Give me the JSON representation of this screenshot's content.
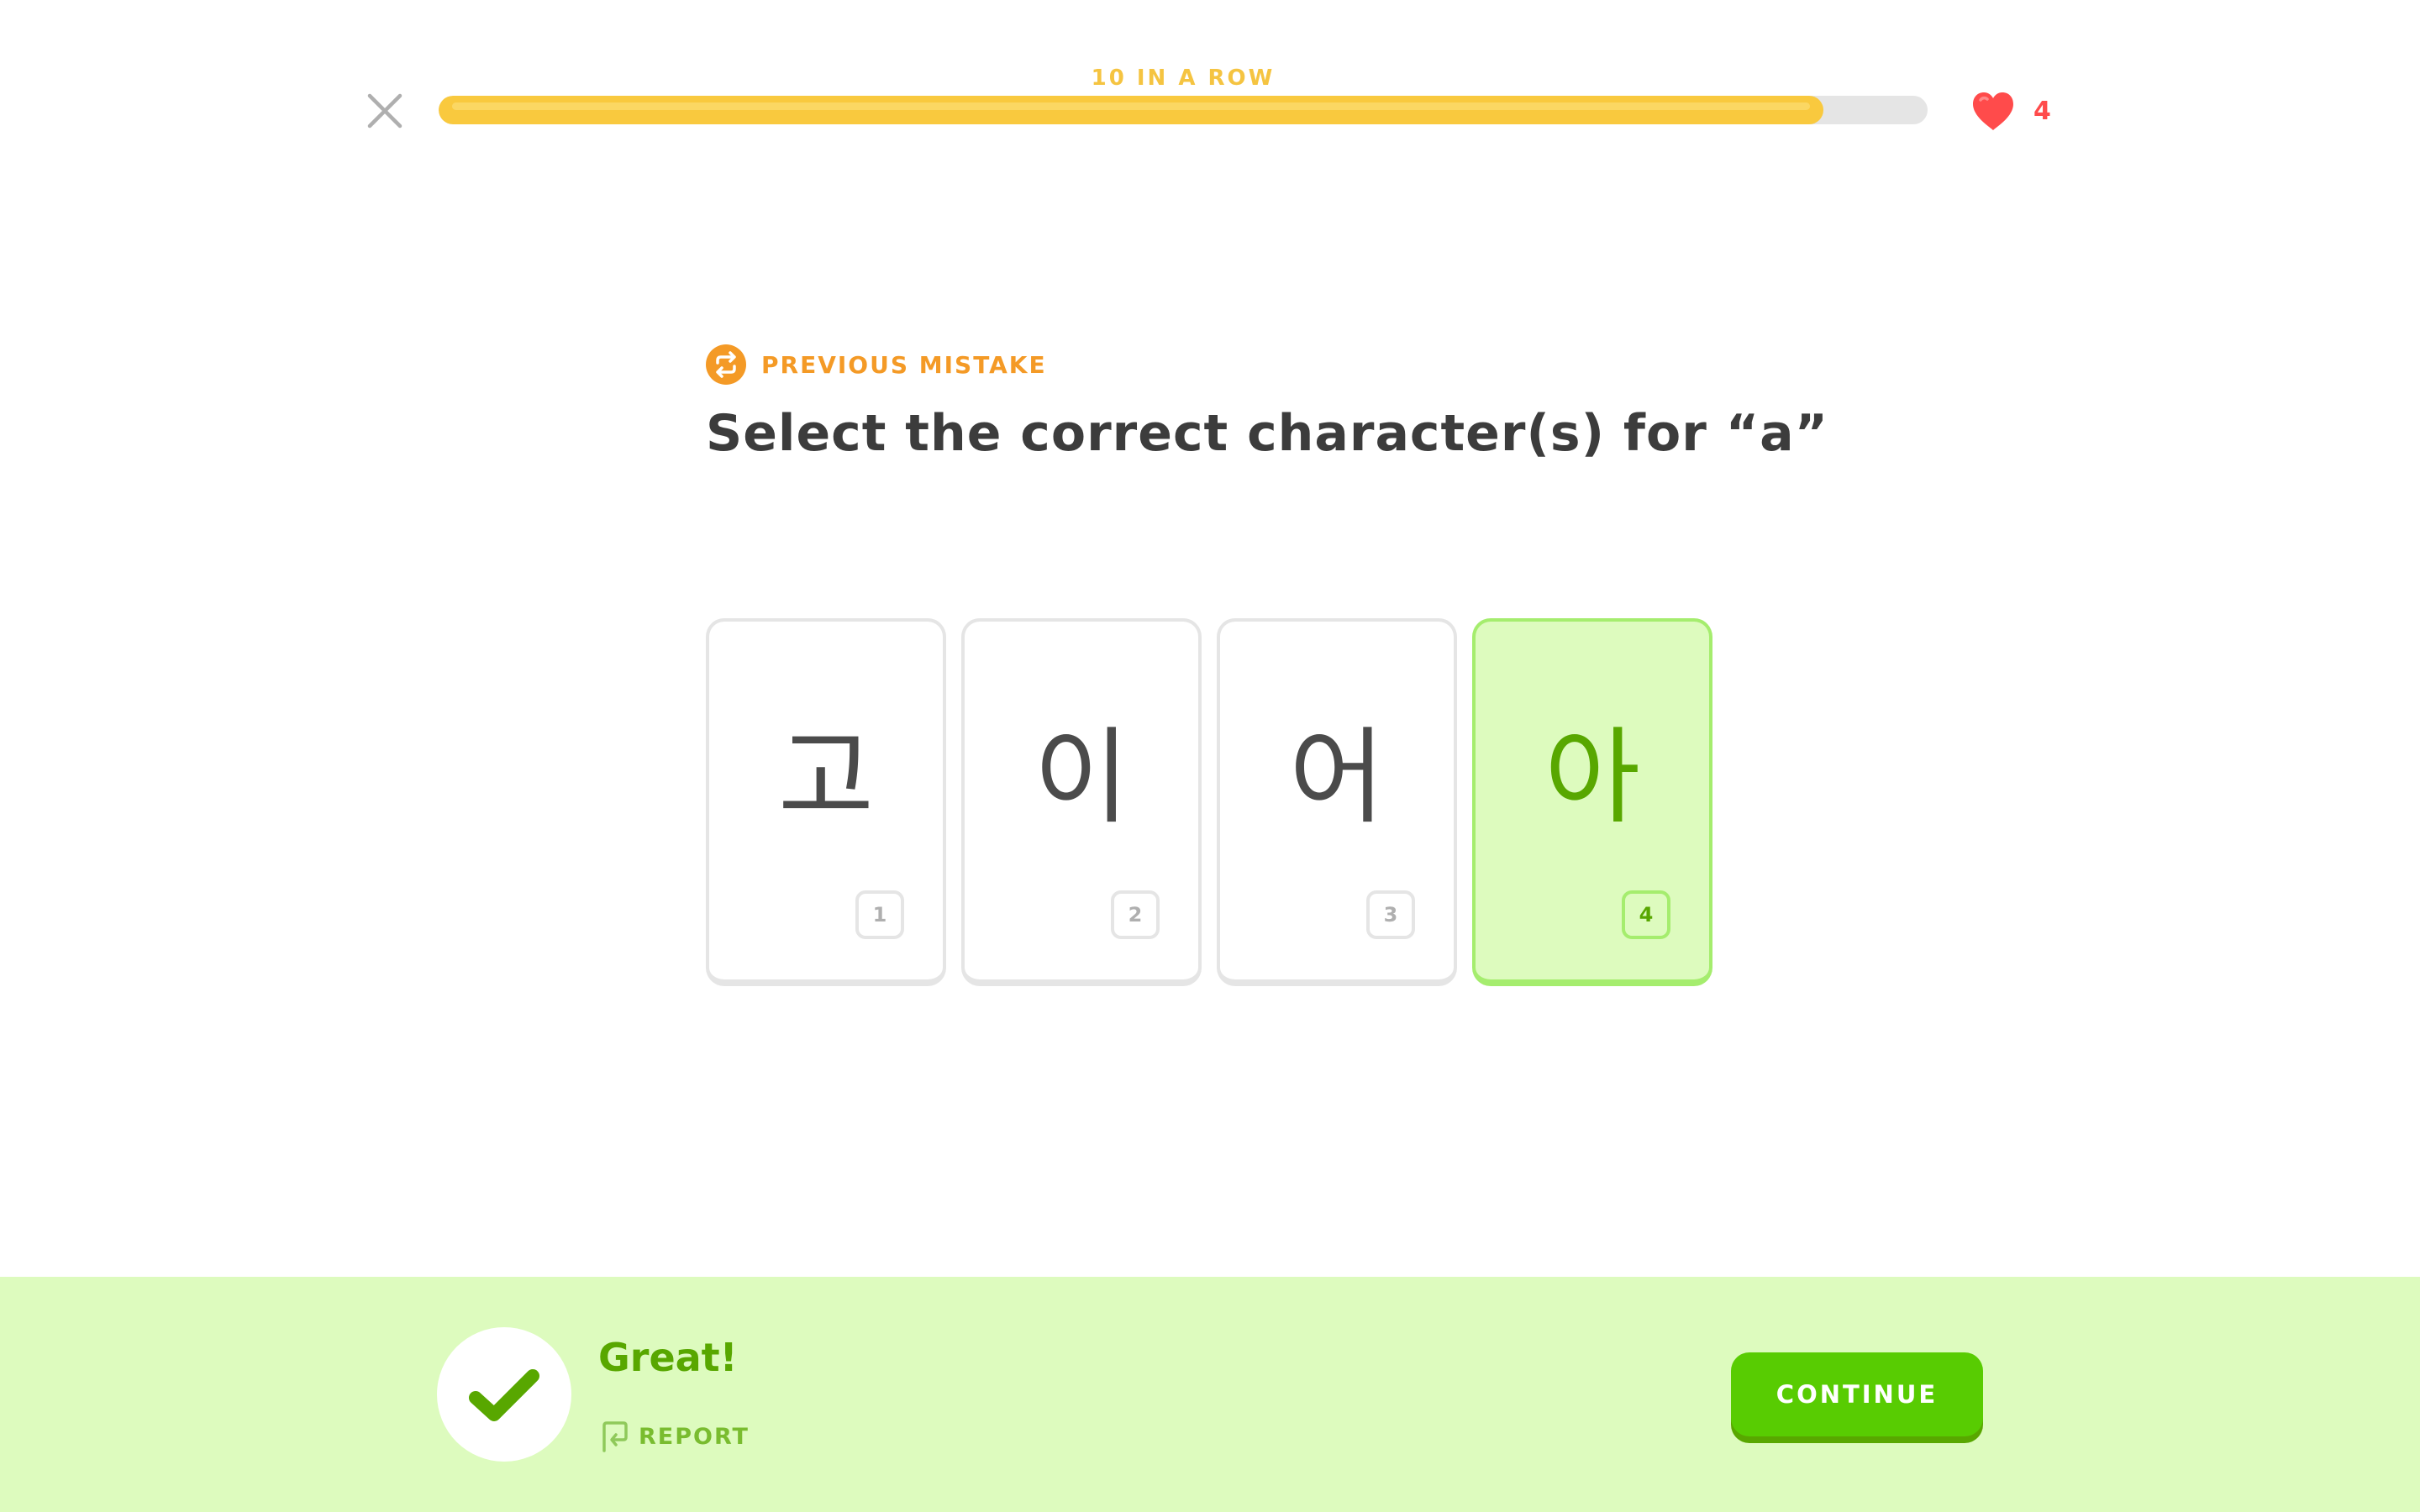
{
  "header": {
    "streak_label": "10 IN A ROW",
    "progress": 0.93,
    "hearts_count": "4",
    "close_icon": "close-icon",
    "heart_icon": "heart-icon"
  },
  "question": {
    "badge_icon": "repeat-icon",
    "badge_label": "PREVIOUS MISTAKE",
    "prompt": "Select the correct character(s) for “a”"
  },
  "choices": [
    {
      "glyph": "고",
      "key": "1",
      "selected": false
    },
    {
      "glyph": "이",
      "key": "2",
      "selected": false
    },
    {
      "glyph": "어",
      "key": "3",
      "selected": false
    },
    {
      "glyph": "아",
      "key": "4",
      "selected": true
    }
  ],
  "feedback": {
    "status_icon": "checkmark-icon",
    "message": "Great!",
    "report_icon": "flag-icon",
    "report_label": "REPORT",
    "continue_label": "CONTINUE"
  },
  "colors": {
    "streak_gold": "#f9c93e",
    "heart_red": "#ff4b4b",
    "mistake_orange": "#f49a26",
    "correct_green": "#58a700",
    "button_green": "#58cc02",
    "feedback_bg": "#ddfbbe"
  }
}
